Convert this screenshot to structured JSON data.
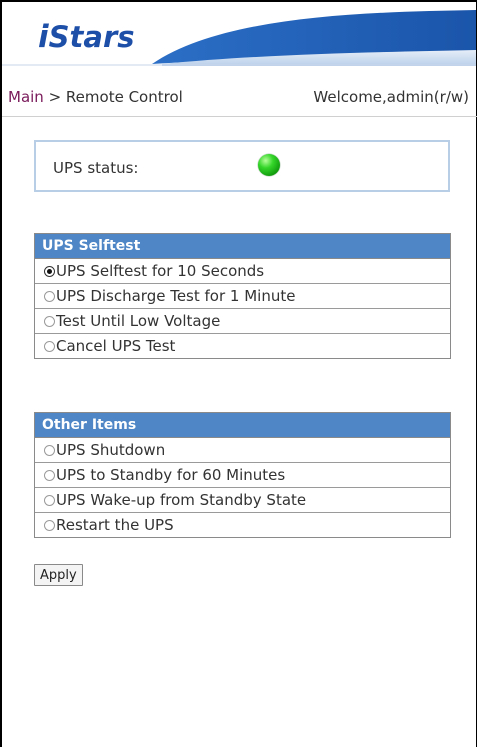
{
  "header": {
    "logo_prefix": "i",
    "logo_rest": "Stars",
    "brand_color": "#1e4fa8"
  },
  "breadcrumb": {
    "main": "Main",
    "separator": " > ",
    "current": "Remote Control"
  },
  "welcome": "Welcome,admin(r/w)",
  "status": {
    "label": "UPS status:",
    "indicator": "green"
  },
  "selftest": {
    "title": "UPS Selftest",
    "options": [
      {
        "label": "UPS Selftest for 10 Seconds",
        "checked": true
      },
      {
        "label": "UPS Discharge Test for 1 Minute",
        "checked": false
      },
      {
        "label": "Test Until Low Voltage",
        "checked": false
      },
      {
        "label": "Cancel UPS Test",
        "checked": false
      }
    ]
  },
  "other": {
    "title": "Other Items",
    "options": [
      {
        "label": "UPS Shutdown",
        "checked": false
      },
      {
        "label": "UPS to Standby for 60 Minutes",
        "checked": false
      },
      {
        "label": "UPS Wake-up from Standby State",
        "checked": false
      },
      {
        "label": "Restart the UPS",
        "checked": false
      }
    ]
  },
  "apply_label": "Apply",
  "colors": {
    "panel_header": "#4e86c6",
    "status_border": "#b8cde6",
    "link": "#7a1a5a"
  }
}
